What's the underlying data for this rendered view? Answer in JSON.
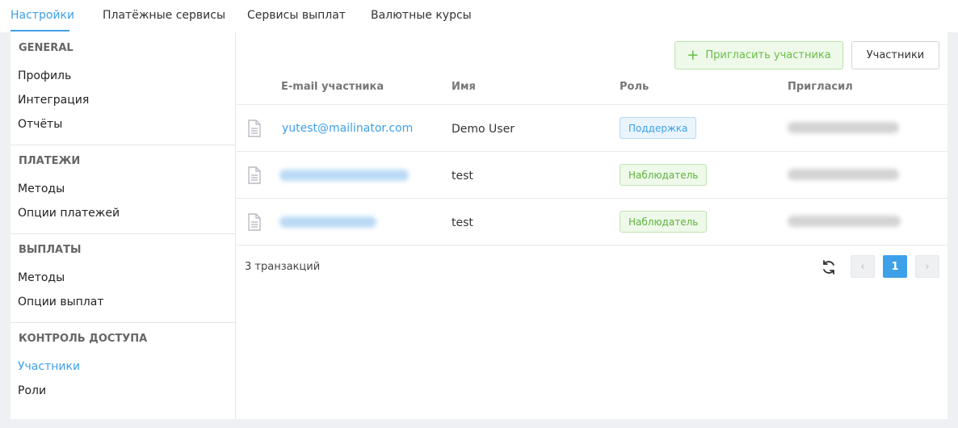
{
  "tabs": [
    {
      "label": "Настройки",
      "active": true
    },
    {
      "label": "Платёжные сервисы",
      "active": false
    },
    {
      "label": "Сервисы выплат",
      "active": false
    },
    {
      "label": "Валютные курсы",
      "active": false
    }
  ],
  "sidebar": {
    "sections": [
      {
        "title": "GENERAL",
        "items": [
          "Профиль",
          "Интеграция",
          "Отчёты"
        ]
      },
      {
        "title": "ПЛАТЕЖИ",
        "items": [
          "Методы",
          "Опции платежей"
        ]
      },
      {
        "title": "ВЫПЛАТЫ",
        "items": [
          "Методы",
          "Опции выплат"
        ]
      },
      {
        "title": "КОНТРОЛЬ ДОСТУПА",
        "items": [
          "Участники",
          "Роли"
        ]
      }
    ],
    "active_item": "Участники"
  },
  "toolbar": {
    "invite_label": "Пригласить участника",
    "members_label": "Участники"
  },
  "table": {
    "headers": [
      "E-mail участника",
      "Имя",
      "Роль",
      "Пригласил"
    ],
    "rows": [
      {
        "email": "yutest@mailinator.com",
        "name": "Demo User",
        "role": "Поддержка",
        "role_type": "support"
      },
      {
        "email": "",
        "name": "test",
        "role": "Наблюдатель",
        "role_type": "observer"
      },
      {
        "email": "",
        "name": "test",
        "role": "Наблюдатель",
        "role_type": "observer"
      }
    ]
  },
  "footer": {
    "count_text": "3 транзакций",
    "current_page": "1",
    "prev_label": "‹",
    "next_label": "›"
  },
  "colors": {
    "accent": "#3ea0e9",
    "success": "#68bd45",
    "background": "#eef0f4"
  },
  "icons": {
    "row_icon": "document-icon",
    "refresh": "refresh-icon",
    "invite": "plus-icon"
  }
}
